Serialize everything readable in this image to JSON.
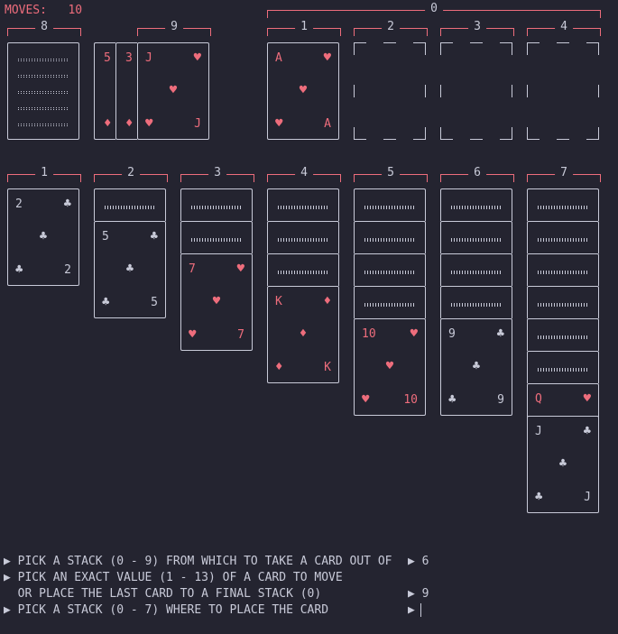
{
  "status": {
    "moves_label": "MOVES:",
    "moves_value": "10"
  },
  "colors": {
    "background": "#242430",
    "red": "#ee6d7c",
    "light": "#c8cad8"
  },
  "top_row": {
    "stock": {
      "label": "8"
    },
    "waste": {
      "label": "9",
      "slivers": [
        {
          "value": "5",
          "suit": "♦"
        },
        {
          "value": "3",
          "suit": "♦"
        }
      ],
      "top_card": {
        "value": "J",
        "suit": "♥",
        "color": "red"
      }
    },
    "foundations": {
      "group_label": "0",
      "piles": [
        {
          "label": "1",
          "card": {
            "value": "A",
            "suit": "♥",
            "color": "red"
          }
        },
        {
          "label": "2",
          "card": null
        },
        {
          "label": "3",
          "card": null
        },
        {
          "label": "4",
          "card": null
        }
      ]
    }
  },
  "tableau": [
    {
      "label": "1",
      "hidden": 0,
      "cards": [
        {
          "value": "2",
          "suit": "♣",
          "color": "black"
        }
      ]
    },
    {
      "label": "2",
      "hidden": 1,
      "cards": [
        {
          "value": "5",
          "suit": "♣",
          "color": "black"
        }
      ]
    },
    {
      "label": "3",
      "hidden": 2,
      "cards": [
        {
          "value": "7",
          "suit": "♥",
          "color": "red"
        }
      ]
    },
    {
      "label": "4",
      "hidden": 3,
      "cards": [
        {
          "value": "K",
          "suit": "♦",
          "color": "red"
        }
      ]
    },
    {
      "label": "5",
      "hidden": 4,
      "cards": [
        {
          "value": "10",
          "suit": "♥",
          "color": "red"
        }
      ]
    },
    {
      "label": "6",
      "hidden": 4,
      "cards": [
        {
          "value": "9",
          "suit": "♣",
          "color": "black"
        }
      ]
    },
    {
      "label": "7",
      "hidden": 6,
      "cards": [
        {
          "value": "Q",
          "suit": "♥",
          "color": "red"
        },
        {
          "value": "J",
          "suit": "♣",
          "color": "black"
        }
      ]
    }
  ],
  "prompts": {
    "arrow": "▶",
    "line1": "PICK A STACK (0 - 9) FROM WHICH TO TAKE A CARD OUT OF",
    "answer1": "6",
    "line2": "PICK AN EXACT VALUE (1 - 13) OF A CARD TO MOVE",
    "line3": "OR PLACE THE LAST CARD TO A FINAL STACK (0)",
    "answer2": "9",
    "line4": "PICK A STACK (0 - 7) WHERE TO PLACE THE CARD",
    "answer3": ""
  }
}
